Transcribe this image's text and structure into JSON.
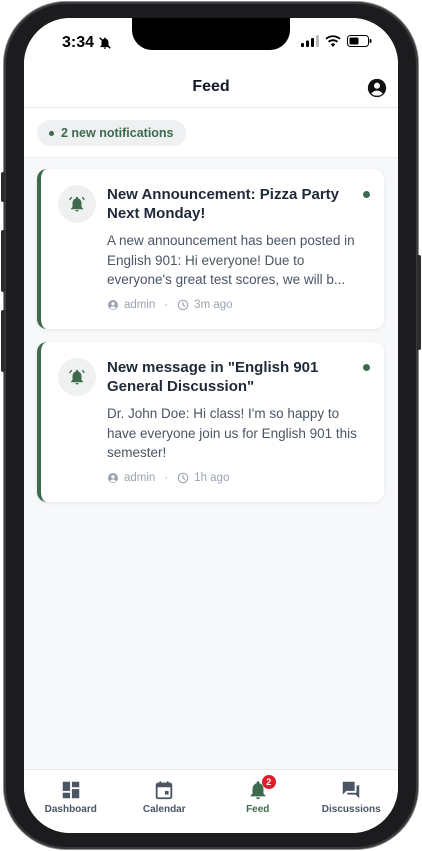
{
  "status": {
    "time": "3:34"
  },
  "header": {
    "title": "Feed"
  },
  "notifications_pill": {
    "label": "2 new notifications"
  },
  "feed": [
    {
      "title": "New Announcement: Pizza Party Next Monday!",
      "body": "A new announcement has been posted in English 901: Hi everyone! Due to everyone's great test scores, we will b...",
      "author": "admin",
      "time": "3m ago"
    },
    {
      "title": "New message in \"English 901 General Discussion\"",
      "body": "Dr. John Doe: Hi class! I'm so happy to have everyone join us for English 901 this semester!",
      "author": "admin",
      "time": "1h ago"
    }
  ],
  "tabs": [
    {
      "label": "Dashboard",
      "icon": "dashboard-icon"
    },
    {
      "label": "Calendar",
      "icon": "calendar-icon"
    },
    {
      "label": "Feed",
      "icon": "bell-icon",
      "badge": "2"
    },
    {
      "label": "Discussions",
      "icon": "chat-icon"
    }
  ],
  "colors": {
    "accent": "#3d6a4d",
    "badge": "#e11d2e"
  }
}
